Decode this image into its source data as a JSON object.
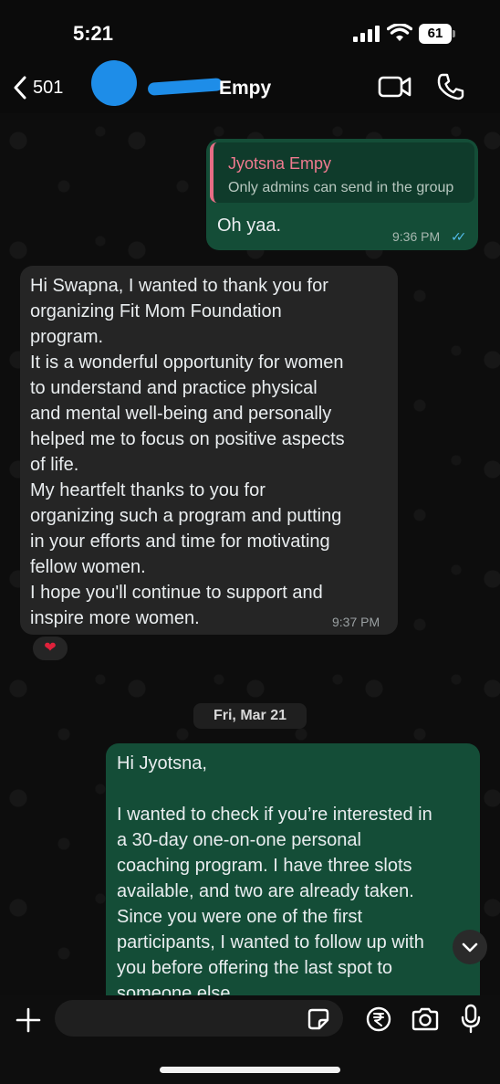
{
  "status_bar": {
    "time": "5:21",
    "battery": "61"
  },
  "header": {
    "back_count": "501",
    "contact_name": "Empy"
  },
  "messages": [
    {
      "direction": "outgoing",
      "quoted_author": "Jyotsna Empy",
      "quoted_text": "Only admins can send in the group",
      "text": "Oh yaa.",
      "time": "9:36 PM",
      "ticks": "✓✓"
    },
    {
      "direction": "incoming",
      "lines": [
        "Hi Swapna, I wanted to thank you for",
        "organizing Fit Mom Foundation",
        "program.",
        "It is a wonderful opportunity for  women",
        "to understand  and practice physical",
        "and mental well-being and personally",
        "helped me to focus on positive aspects",
        "of life.",
        "My heartfelt thanks to you for",
        "organizing such a program  and putting",
        "in your efforts and time for motivating",
        "fellow women.",
        "I hope you'll continue to support and",
        "inspire more women."
      ],
      "time": "9:37 PM",
      "reaction": "❤"
    },
    {
      "direction": "outgoing",
      "lines": [
        "Hi Jyotsna,",
        "",
        "I wanted to check if you’re interested in",
        "a 30-day one-on-one personal",
        "coaching program. I have three slots",
        "available, and two are already taken.",
        "Since you were one of the first",
        "participants, I wanted to follow up with",
        "you before offering the last spot to",
        "someone else."
      ]
    }
  ],
  "date_divider": "Fri, Mar 21",
  "composer": {
    "placeholder": ""
  },
  "colors": {
    "outgoing_bubble": "#144d37",
    "incoming_bubble": "#252525",
    "quote_author": "#ef7a8f",
    "read_ticks": "#53bdeb",
    "redaction": "#1e8de8"
  },
  "icons": [
    "signal-icon",
    "wifi-icon",
    "battery-icon",
    "back-chevron-icon",
    "video-call-icon",
    "phone-icon",
    "heart-icon",
    "chevron-down-icon",
    "plus-icon",
    "sticker-icon",
    "rupee-icon",
    "camera-icon",
    "mic-icon"
  ]
}
